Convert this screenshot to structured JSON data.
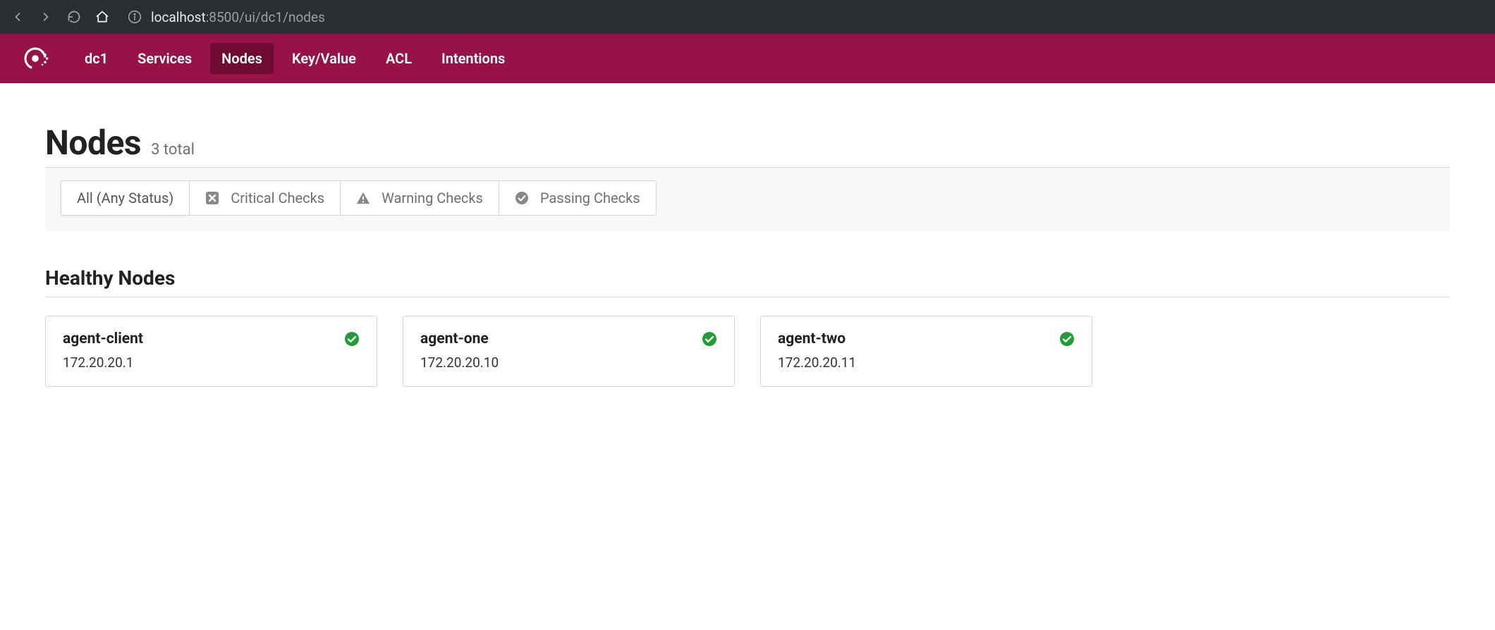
{
  "browser": {
    "url_host": "localhost",
    "url_rest": ":8500/ui/dc1/nodes"
  },
  "nav": {
    "datacenter": "dc1",
    "items": [
      {
        "label": "Services",
        "active": false
      },
      {
        "label": "Nodes",
        "active": true
      },
      {
        "label": "Key/Value",
        "active": false
      },
      {
        "label": "ACL",
        "active": false
      },
      {
        "label": "Intentions",
        "active": false
      }
    ]
  },
  "page": {
    "title": "Nodes",
    "total_label": "3 total"
  },
  "filters": [
    {
      "label": "All (Any Status)",
      "icon": "none",
      "active": true
    },
    {
      "label": "Critical Checks",
      "icon": "critical",
      "active": false
    },
    {
      "label": "Warning Checks",
      "icon": "warning",
      "active": false
    },
    {
      "label": "Passing Checks",
      "icon": "passing",
      "active": false
    }
  ],
  "section": {
    "title": "Healthy Nodes"
  },
  "nodes": [
    {
      "name": "agent-client",
      "ip": "172.20.20.1",
      "status": "passing"
    },
    {
      "name": "agent-one",
      "ip": "172.20.20.10",
      "status": "passing"
    },
    {
      "name": "agent-two",
      "ip": "172.20.20.11",
      "status": "passing"
    }
  ],
  "colors": {
    "brand": "#961247",
    "brand_dark": "#6f0a33",
    "passing": "#209e35",
    "icon_grey": "#888888"
  }
}
